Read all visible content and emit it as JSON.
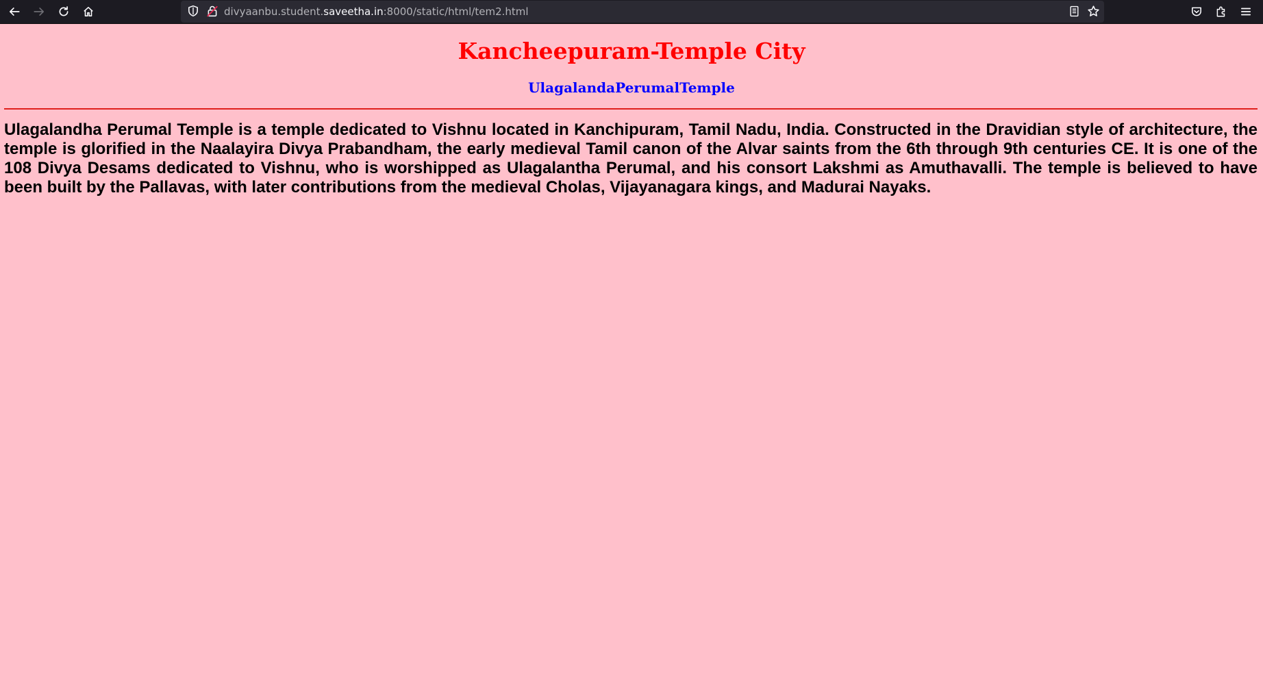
{
  "browser": {
    "url_prefix": "divyaanbu.student.",
    "url_domain": "saveetha.in",
    "url_suffix": ":8000/static/html/tem2.html"
  },
  "page": {
    "title": "Kancheepuram-Temple City",
    "subtitle": "UlagalandaPerumalTemple",
    "paragraph": "Ulagalandha Perumal Temple is a temple dedicated to Vishnu located in Kanchipuram, Tamil Nadu, India. Constructed in the Dravidian style of architecture, the temple is glorified in the Naalayira Divya Prabandham, the early medieval Tamil canon of the Alvar saints from the 6th through 9th centuries CE. It is one of the 108 Divya Desams dedicated to Vishnu, who is worshipped as Ulagalantha Perumal, and his consort Lakshmi as Amuthavalli. The temple is believed to have been built by the Pallavas, with later contributions from the medieval Cholas, Vijayanagara kings, and Madurai Nayaks."
  },
  "colors": {
    "page_background": "#ffc0cb",
    "title": "#ff0000",
    "subtitle": "#0000ff",
    "rule": "#e0201c",
    "toolbar": "#1c1b22"
  },
  "icons": [
    "back-arrow-icon",
    "forward-arrow-icon",
    "reload-icon",
    "home-icon",
    "shield-icon",
    "lock-icon",
    "reader-view-icon",
    "bookmark-star-icon",
    "pocket-icon",
    "extensions-icon",
    "menu-icon"
  ]
}
